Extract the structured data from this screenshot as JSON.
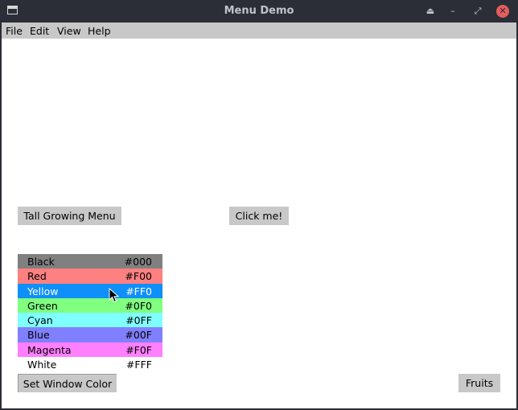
{
  "window": {
    "title": "Menu Demo"
  },
  "titlebar_buttons": {
    "shade_icon": "eject-icon",
    "minimize_icon": "minimize-icon",
    "maximize_icon": "restore-icon",
    "close_icon": "close-icon",
    "shade_glyph": "⏏",
    "minimize_glyph": "–",
    "maximize_glyph": "⤢",
    "close_glyph": "✕",
    "close_color": "#e35d5d"
  },
  "menubar": {
    "items": [
      "File",
      "Edit",
      "View",
      "Help"
    ]
  },
  "buttons": {
    "tall_growing_menu": "Tall Growing Menu",
    "click_me": "Click me!",
    "set_window_color": "Set Window Color",
    "fruits": "Fruits"
  },
  "colors": [
    {
      "name": "Black",
      "hex": "#000",
      "bg": "#808080",
      "text_color": "#000000"
    },
    {
      "name": "Red",
      "hex": "#F00",
      "bg": "#ff8080",
      "text_color": "#000000"
    },
    {
      "name": "Yellow",
      "hex": "#FF0",
      "bg": "#0f8ff8",
      "text_color": "#ffffff"
    },
    {
      "name": "Green",
      "hex": "#0F0",
      "bg": "#80ff80",
      "text_color": "#000000"
    },
    {
      "name": "Cyan",
      "hex": "#0FF",
      "bg": "#80ffff",
      "text_color": "#000000"
    },
    {
      "name": "Blue",
      "hex": "#00F",
      "bg": "#8080ff",
      "text_color": "#000000"
    },
    {
      "name": "Magenta",
      "hex": "#F0F",
      "bg": "#ff80ff",
      "text_color": "#000000"
    },
    {
      "name": "White",
      "hex": "#FFF",
      "bg": "#ffffff",
      "text_color": "#000000"
    }
  ],
  "selected_color": "Yellow"
}
